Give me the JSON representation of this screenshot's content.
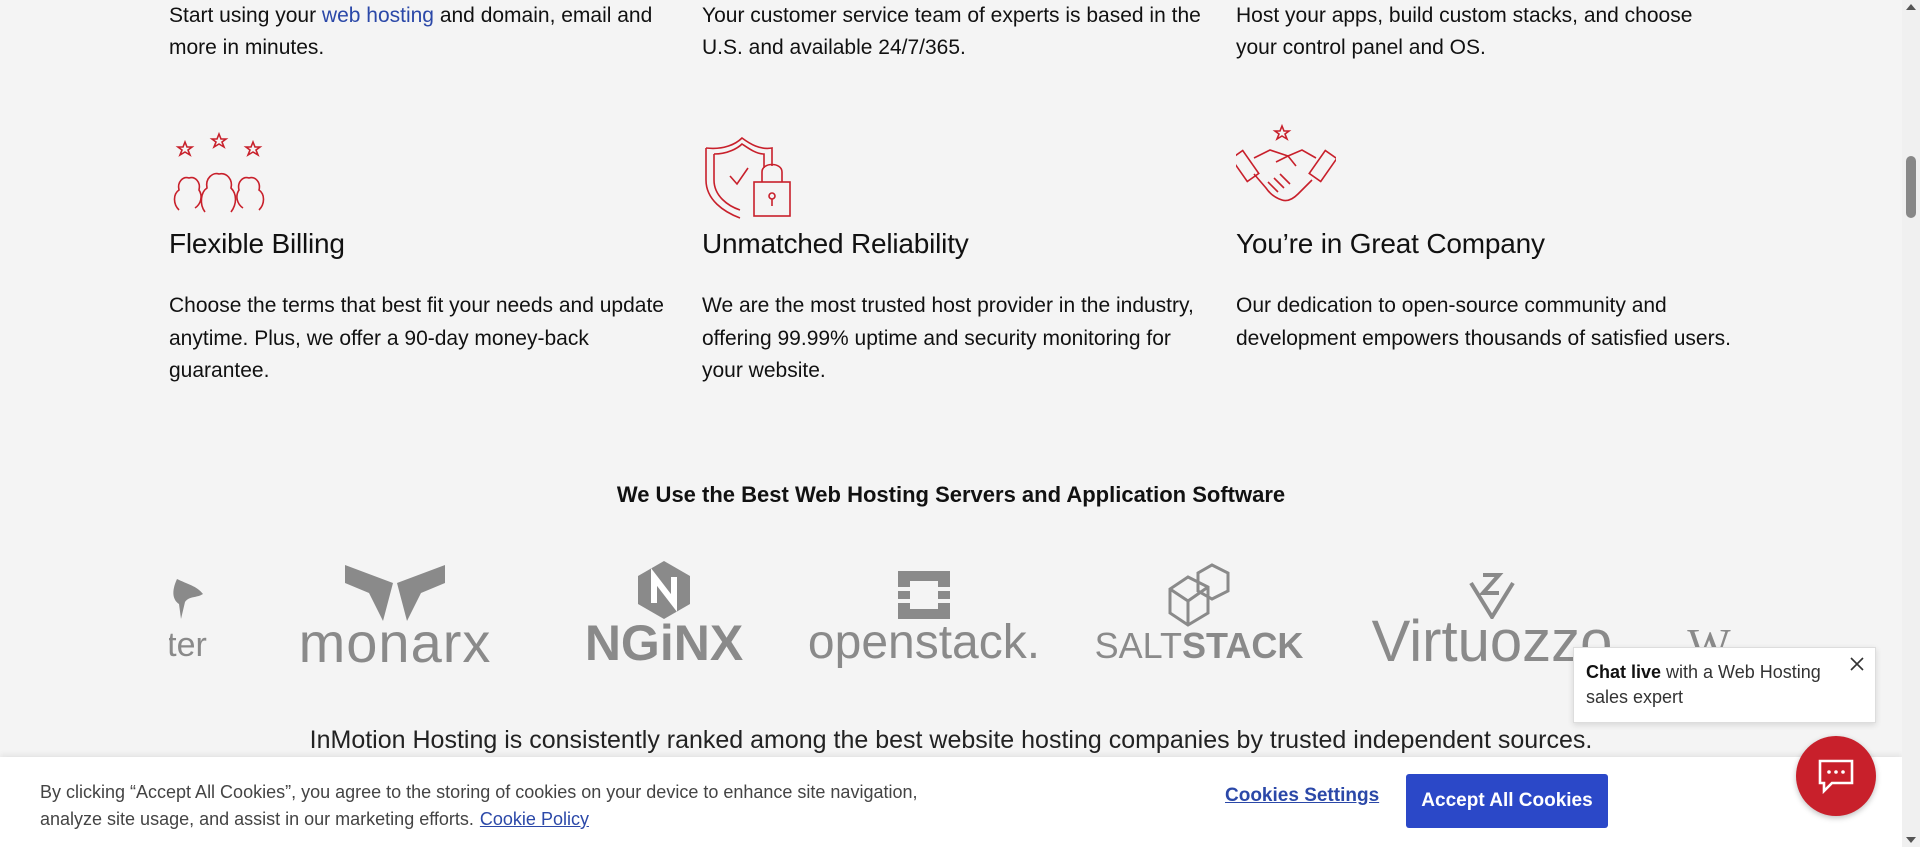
{
  "top_row": [
    {
      "before": "Start using your ",
      "link": "web hosting",
      "after": " and domain, email and more in minutes."
    },
    {
      "text": "Your customer service team of experts is based in the U.S. and available 24/7/365."
    },
    {
      "text": "Host your apps, build custom stacks, and choose your control panel and OS."
    }
  ],
  "features": [
    {
      "icon": "people-stars-icon",
      "title": "Flexible Billing",
      "desc": "Choose the terms that best fit your needs and update anytime. Plus, we offer a 90-day money-back guarantee."
    },
    {
      "icon": "shield-lock-icon",
      "title": "Unmatched Reliability",
      "desc": "We are the most trusted host provider in the industry, offering 99.99% uptime and security monitoring for your website."
    },
    {
      "icon": "handshake-star-icon",
      "title": "You’re in Great Company",
      "desc": "Our dedication to open-source community and development empowers thousands of satisfied users."
    }
  ],
  "servers_heading": "We Use the Best Web Hosting Servers and Application Software",
  "logos": {
    "partial_left": "ter",
    "monarx": "monarx",
    "nginx": "NGiNX",
    "openstack": "openstack.",
    "saltstack_light": "SALT",
    "saltstack_bold": "STACK",
    "virtuozzo": "Virtuozzo",
    "partial_right": "W"
  },
  "ranked_text": "InMotion Hosting is consistently ranked among the best website hosting companies by trusted independent sources.",
  "cookie": {
    "text": "By clicking “Accept All Cookies”, you agree to the storing of cookies on your device to enhance site navigation, analyze site usage, and assist in our marketing efforts.",
    "policy_link": "Cookie Policy",
    "settings_label": "Cookies Settings",
    "accept_label": "Accept All Cookies"
  },
  "chat": {
    "bold": "Chat live",
    "rest": " with a Web Hosting sales expert"
  },
  "colors": {
    "accent_red": "#c8202b",
    "link_blue": "#2b48a8",
    "button_blue": "#2b48c8",
    "logo_gray": "#8a8a8a"
  }
}
